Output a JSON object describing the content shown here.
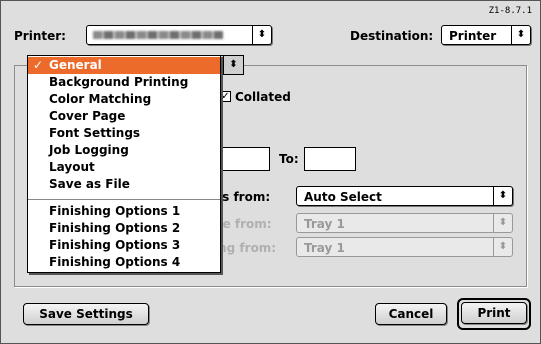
{
  "version": "Z1-8.7.1",
  "printer": {
    "label": "Printer:"
  },
  "destination": {
    "label": "Destination:",
    "value": "Printer"
  },
  "settings_popup": {
    "value": "General"
  },
  "menu": {
    "items": [
      {
        "label": "General",
        "selected": true,
        "check": "✓"
      },
      {
        "label": "Background Printing"
      },
      {
        "label": "Color Matching"
      },
      {
        "label": "Cover Page"
      },
      {
        "label": "Font Settings"
      },
      {
        "label": "Job Logging"
      },
      {
        "label": "Layout"
      },
      {
        "label": "Save as File"
      },
      {
        "label": "Finishing Options 1"
      },
      {
        "label": "Finishing Options 2"
      },
      {
        "label": "Finishing Options 3"
      },
      {
        "label": "Finishing Options 4"
      }
    ]
  },
  "collated": {
    "label": "Collated",
    "checked": true,
    "mark": "✓"
  },
  "pages": {
    "to_label": "To:",
    "from_value": "",
    "to_value": ""
  },
  "paper_source": {
    "all_pages_label": "es from:",
    "all_pages_value": "Auto Select",
    "first_page_label": "ge from:",
    "first_page_value": "Tray 1",
    "remaining_label": "ing from:",
    "remaining_value": "Tray 1"
  },
  "buttons": {
    "save_settings": "Save Settings",
    "cancel": "Cancel",
    "print": "Print"
  },
  "icons": {
    "popup_arrow": "⬍"
  }
}
